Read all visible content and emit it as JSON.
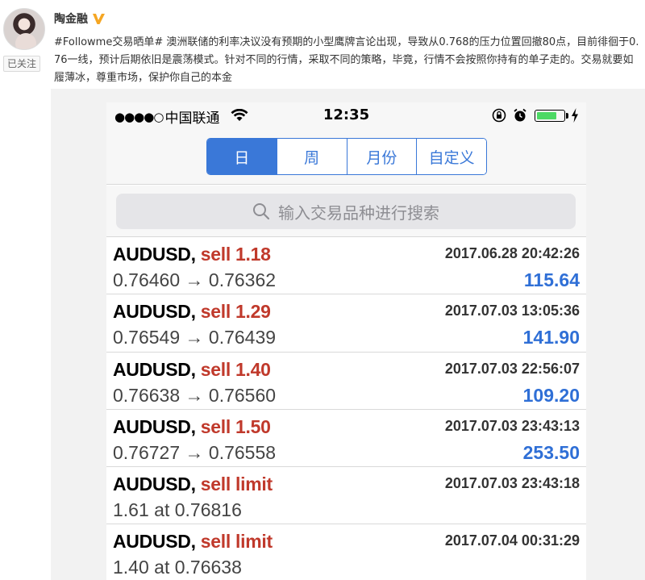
{
  "post": {
    "author": "陶金融",
    "follow_label": "已关注",
    "text": "#Followme交易晒单# 澳洲联储的利率决议没有预期的小型鹰牌言论出现，导致从0.768的压力位置回撤80点，目前徘徊于0.76一线，预计后期依旧是震荡模式。针对不同的行情，采取不同的策略，毕竟，行情不会按照你持有的单子走的。交易就要如履薄冰，尊重市场，保护你自己的本金"
  },
  "phone": {
    "status": {
      "signal_dots": "●●●●○",
      "carrier": "中国联通",
      "time": "12:35",
      "battery_level": 0.75
    },
    "tabs": [
      {
        "label": "日",
        "active": true
      },
      {
        "label": "周",
        "active": false
      },
      {
        "label": "月份",
        "active": false
      },
      {
        "label": "自定义",
        "active": false
      }
    ],
    "search": {
      "placeholder": "输入交易品种进行搜索"
    },
    "trades": [
      {
        "symbol": "AUDUSD",
        "side": "sell 1.18",
        "time": "2017.06.28 20:42:26",
        "detail": "0.76460 → 0.76362",
        "profit": "115.64"
      },
      {
        "symbol": "AUDUSD",
        "side": "sell 1.29",
        "time": "2017.07.03 13:05:36",
        "detail": "0.76549 → 0.76439",
        "profit": "141.90"
      },
      {
        "symbol": "AUDUSD",
        "side": "sell 1.40",
        "time": "2017.07.03 22:56:07",
        "detail": "0.76638 → 0.76560",
        "profit": "109.20"
      },
      {
        "symbol": "AUDUSD",
        "side": "sell 1.50",
        "time": "2017.07.03 23:43:13",
        "detail": "0.76727 → 0.76558",
        "profit": "253.50"
      },
      {
        "symbol": "AUDUSD",
        "side": "sell limit",
        "time": "2017.07.03 23:43:18",
        "detail": "1.61 at 0.76816",
        "profit": ""
      },
      {
        "symbol": "AUDUSD",
        "side": "sell limit",
        "time": "2017.07.04 00:31:29",
        "detail": "1.40 at 0.76638",
        "profit": ""
      }
    ]
  },
  "colors": {
    "accent": "#3a78d8",
    "sell": "#c0392b",
    "profit": "#2f6fd6",
    "battery": "#4cd964"
  }
}
